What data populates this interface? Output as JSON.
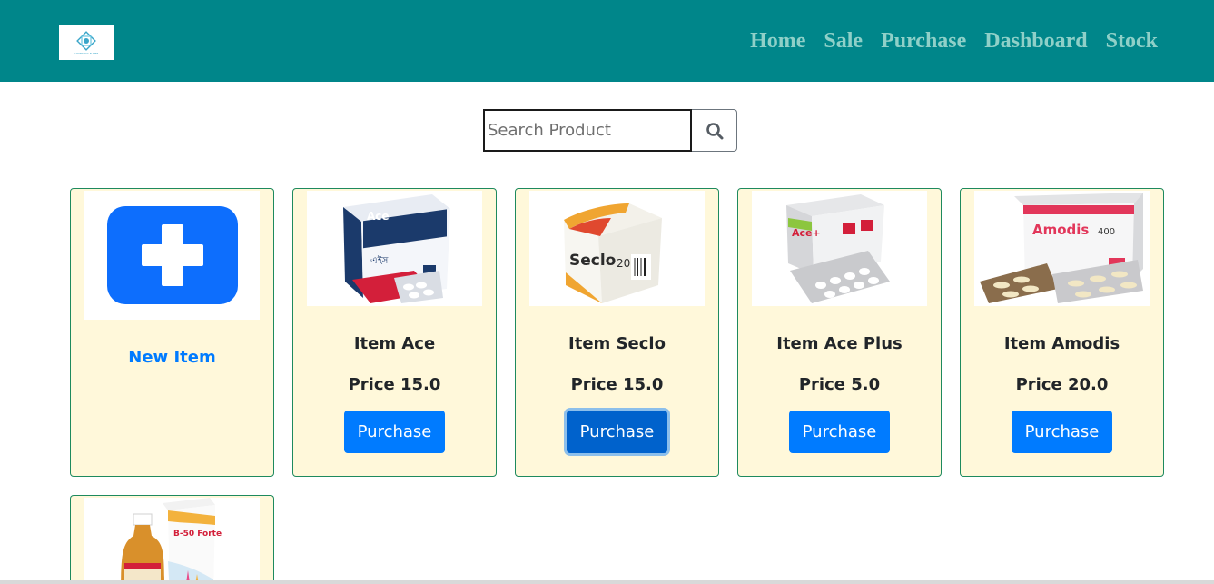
{
  "brand": {
    "logo_text": "COMPANY NAME"
  },
  "nav": {
    "items": [
      {
        "label": "Home"
      },
      {
        "label": "Sale"
      },
      {
        "label": "Purchase"
      },
      {
        "label": "Dashboard"
      },
      {
        "label": "Stock"
      }
    ]
  },
  "search": {
    "placeholder": "Search Product",
    "value": ""
  },
  "new_item": {
    "label": "New Item"
  },
  "products": [
    {
      "title": "Item Ace",
      "price": "Price 15.0",
      "button": "Purchase"
    },
    {
      "title": "Item Seclo",
      "price": "Price 15.0",
      "button": "Purchase"
    },
    {
      "title": "Item Ace Plus",
      "price": "Price 5.0",
      "button": "Purchase"
    },
    {
      "title": "Item Amodis",
      "price": "Price 20.0",
      "button": "Purchase"
    }
  ],
  "product_images": {
    "ace": {
      "brand": "Ace",
      "bangla": "এইস"
    },
    "seclo": {
      "brand": "Seclo",
      "strength": "20"
    },
    "ace_plus": {
      "brand": "Ace+"
    },
    "amodis": {
      "brand": "Amodis",
      "strength": "400"
    },
    "b50": {
      "brand": "B-50 Forte"
    }
  },
  "colors": {
    "navbar": "#00868a",
    "nav_text": "#8fd0c8",
    "card_bg": "#fff8da",
    "card_border": "#1e8a5e",
    "primary": "#007bff"
  }
}
